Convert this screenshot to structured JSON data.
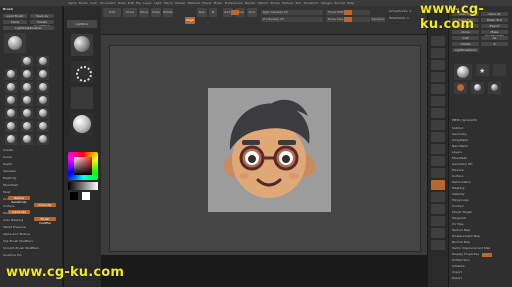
{
  "menu": {
    "items": [
      "Alpha",
      "Brush",
      "Color",
      "Document",
      "Draw",
      "Edit",
      "File",
      "Layer",
      "Light",
      "Macro",
      "Marker",
      "Material",
      "Movie",
      "Picker",
      "Preferences",
      "Render",
      "Stencil",
      "Stroke",
      "Texture",
      "Tool",
      "Transform",
      "Zplugin",
      "Zscript",
      "Help"
    ]
  },
  "brush_panel": {
    "title": "Brush",
    "buttons": [
      "Load Brush",
      "Save As",
      "Clone",
      "Create InsertMesh",
      "Lightbox▸Brushes"
    ],
    "sections": [
      "Create",
      "Curve",
      "Depth",
      "Samples",
      "Elasticity",
      "FiberMesh",
      "Twist",
      "Orientation",
      "Surface",
      "Modifiers",
      "Auto Masking",
      "Tablet Pressure",
      "Alpha and Texture",
      "Clip Brush Modifiers",
      "Smooth Brush Modifiers",
      "Sculptris Pro"
    ],
    "highlight_items": [
      "Radius Sensitivity",
      "Intensity",
      "Alpha tile",
      "Brush modifier"
    ]
  },
  "toolbar": {
    "buttons": [
      "Edit",
      "Draw",
      "Move",
      "Scale",
      "Rotate"
    ],
    "mrgb": "Mrgb",
    "rgb": "Rgb",
    "m": "M",
    "zadd": "Zadd",
    "zsub": "Zsub",
    "zcut": "Zcut",
    "rgb_intensity": "Rgb Intensity 25",
    "z_intensity": "Z Intensity 25",
    "focal_shift": "Focal Shift 0",
    "draw_size": "Draw Size 64",
    "dynamic": "Dynamic",
    "active_points": "ActivePoints: 1",
    "total_points": "TotalPoints: 1"
  },
  "colors": {
    "accent": "#b8672e",
    "panel": "#2f2f2f",
    "viewport": "#3c3c3c",
    "watermark": "#f2ea1c"
  },
  "tool_panel": {
    "title": "Tool",
    "buttons": [
      "Load Tool",
      "Save As",
      "Copy Tool",
      "Paste Tool",
      "Import",
      "Export",
      "Clone",
      "Make PolyMesh3D",
      "GoZ",
      "All",
      "Visible",
      "R",
      "Lightbox▸Tools"
    ],
    "current_tool": "PM3D_Sphere3D",
    "sections": [
      "Subtool",
      "Geometry",
      "ArrayMesh",
      "NanoMesh",
      "Layers",
      "FiberMesh",
      "Geometry HD",
      "Preview",
      "Surface",
      "Deformation",
      "Masking",
      "Visibility",
      "Polygroups",
      "Contact",
      "Morph Target",
      "Polypaint",
      "UV Map",
      "Texture Map",
      "Displacement Map",
      "Normal Map",
      "Vector Displacement Map",
      "Display Properties",
      "Unified Skin",
      "Initialize",
      "Import",
      "Export"
    ]
  },
  "watermarks": {
    "top": "www.cg-ku.com",
    "bottom": "www.cg-ku.com"
  }
}
